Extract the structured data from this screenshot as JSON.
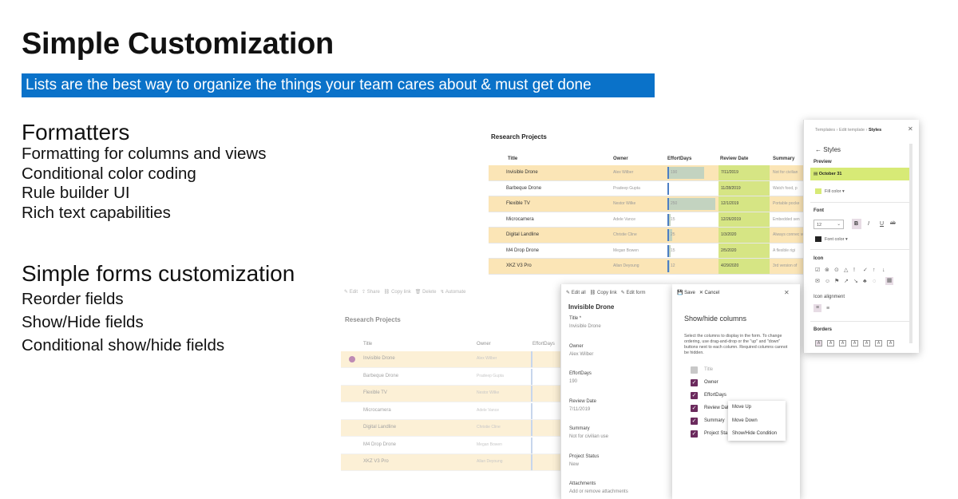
{
  "slide": {
    "title": "Simple Customization",
    "banner": "Lists are the best way to organize the things your team cares about & must get done",
    "formatters": {
      "heading": "Formatters",
      "items": [
        "Formatting for columns and views",
        "Conditional color coding",
        "Rule builder UI",
        "Rich text capabilities"
      ]
    },
    "forms": {
      "heading": "Simple forms customization",
      "items": [
        "Reorder fields",
        "Show/Hide fields",
        "Conditional show/hide fields"
      ]
    }
  },
  "list_view": {
    "title": "Research Projects",
    "columns": [
      "Title",
      "Owner",
      "EffortDays",
      "Review Date",
      "Summary"
    ],
    "rows": [
      {
        "title": "Invisible Drone",
        "owner": "Alex Wilber",
        "effort": "190",
        "date": "7/11/2019",
        "summary": "Not for civilian",
        "highlight": true
      },
      {
        "title": "Barbeque Drone",
        "owner": "Pradeep Gupta",
        "effort": "",
        "date": "11/28/2019",
        "summary": "Watch food, p",
        "highlight": false
      },
      {
        "title": "Flexible TV",
        "owner": "Nestor Wilke",
        "effort": "250",
        "date": "12/1/2019",
        "summary": "Portable pocke",
        "highlight": true
      },
      {
        "title": "Microcamera",
        "owner": "Adele Vance",
        "effort": "15",
        "date": "12/26/2019",
        "summary": "Embedded sen",
        "highlight": false
      },
      {
        "title": "Digital Landline",
        "owner": "Christie Cline",
        "effort": "25",
        "date": "1/3/2020",
        "summary": "Always connec voyages",
        "highlight": true
      },
      {
        "title": "M4 Drop Drone",
        "owner": "Megan Bowen",
        "effort": "15",
        "date": "2/5/2020",
        "summary": "A flexible rigi",
        "highlight": false
      },
      {
        "title": "XKZ V3 Pro",
        "owner": "Allan Deyoung",
        "effort": "12",
        "date": "4/29/2020",
        "summary": "3rd version of",
        "highlight": true
      }
    ]
  },
  "styles_pane": {
    "breadcrumb": [
      "Templates",
      "Edit template",
      "Styles"
    ],
    "back_label": "Styles",
    "preview_label": "Preview",
    "preview_date": "October 31",
    "fill_color_label": "Fill color",
    "font_label": "Font",
    "font_size": "12",
    "bold": "B",
    "italic": "I",
    "underline": "U",
    "strike": "ab",
    "font_color_label": "Font color",
    "icon_label": "Icon",
    "icon_alignment_label": "Icon alignment",
    "borders_label": "Borders",
    "accent_fill": "#d7ea76"
  },
  "faded_list": {
    "toolbar": [
      "Edit",
      "Share",
      "Copy link",
      "Delete",
      "Automate"
    ],
    "title": "Research Projects",
    "columns": [
      "Title",
      "Owner",
      "EffortDays"
    ],
    "rows": [
      {
        "title": "Invisible Drone",
        "owner": "Alex Wilber"
      },
      {
        "title": "Barbeque Drone",
        "owner": "Pradeep Gupta"
      },
      {
        "title": "Flexible TV",
        "owner": "Nestor Wilke"
      },
      {
        "title": "Microcamera",
        "owner": "Adele Vance"
      },
      {
        "title": "Digital Landline",
        "owner": "Christie Cline"
      },
      {
        "title": "M4 Drop Drone",
        "owner": "Megan Bowen"
      },
      {
        "title": "XKZ V3 Pro",
        "owner": "Allan Deyoung"
      }
    ]
  },
  "item_form": {
    "toolbar": [
      "Edit all",
      "Copy link",
      "Edit form"
    ],
    "title": "Invisible Drone",
    "fields": [
      {
        "label": "Title *",
        "value": "Invisible Drone"
      },
      {
        "label": "Owner",
        "value": "Alex Wilber"
      },
      {
        "label": "EffortDays",
        "value": "190"
      },
      {
        "label": "Review Date",
        "value": "7/11/2019"
      },
      {
        "label": "Summary",
        "value": "Not for civilian use"
      },
      {
        "label": "Project Status",
        "value": "New"
      },
      {
        "label": "Attachments",
        "value": "Add or remove attachments"
      }
    ]
  },
  "show_hide": {
    "save_label": "Save",
    "cancel_label": "Cancel",
    "heading": "Show/hide columns",
    "description": "Select the columns to display in the form. To change ordering, use drag-and-drop or the \"up\" and \"down\" buttons next to each column. Required columns cannot be hidden.",
    "columns": [
      {
        "name": "Title",
        "checked": false
      },
      {
        "name": "Owner",
        "checked": true
      },
      {
        "name": "EffortDays",
        "checked": true
      },
      {
        "name": "Review Dat",
        "checked": true
      },
      {
        "name": "Summary",
        "checked": true
      },
      {
        "name": "Project Sta",
        "checked": true
      }
    ],
    "context_menu": [
      "Move Up",
      "Move Down",
      "Show/Hide Condition"
    ],
    "accent": "#6b2a5d"
  },
  "colors": {
    "banner": "#0a72c9",
    "row_highlight": "#fbe5b6",
    "date_highlight": "#d6e584",
    "effort_bar": "#c3d3c0"
  }
}
